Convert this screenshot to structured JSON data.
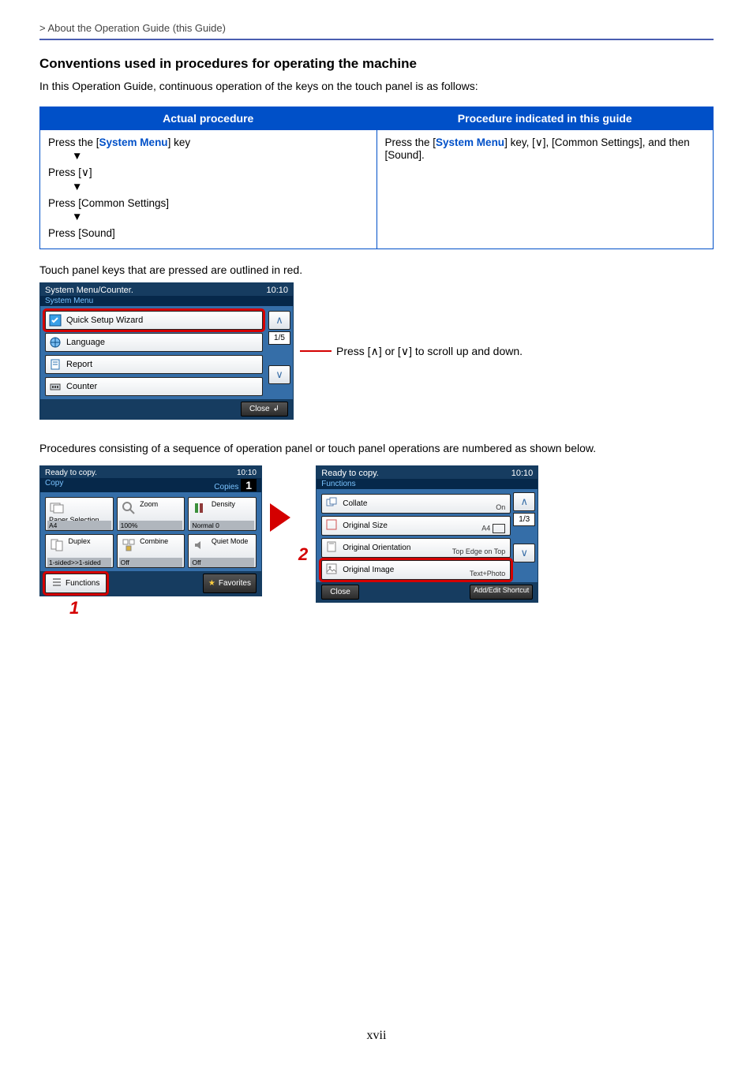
{
  "breadcrumb": " > About the Operation Guide (this Guide)",
  "heading": "Conventions used in procedures for operating the machine",
  "intro": "In this Operation Guide, continuous operation of the keys on the touch panel is as follows:",
  "table": {
    "h1": "Actual procedure",
    "h2": "Procedure indicated in this guide",
    "actual": {
      "s1a": "Press the [",
      "s1b": "System Menu",
      "s1c": "] key",
      "s2": "Press [∨]",
      "s3": "Press [Common Settings]",
      "s4": "Press [Sound]"
    },
    "right": {
      "a": "Press the [",
      "b": "System Menu",
      "c": "] key, [∨], [Common Settings], and then [Sound]."
    }
  },
  "note_outlined": "Touch panel keys that are pressed are outlined in red.",
  "sysmenu_panel": {
    "title": "System Menu/Counter.",
    "time": "10:10",
    "subbar": "System Menu",
    "items": [
      "Quick Setup Wizard",
      "Language",
      "Report",
      "Counter"
    ],
    "page": "1/5",
    "close": "Close"
  },
  "scroll_tip": "Press [∧] or [∨] to scroll up and down.",
  "seq_text": "Procedures consisting of a sequence of operation panel or touch panel operations are numbered as shown below.",
  "copy_panel": {
    "title": "Ready to copy.",
    "time": "10:10",
    "subbar_label": "Copy",
    "copies_label": "Copies",
    "copies_value": "1",
    "cells": [
      {
        "label": "Paper Selection",
        "val": "A4"
      },
      {
        "label": "Zoom",
        "val": "100%"
      },
      {
        "label": "Density",
        "val": "Normal 0"
      },
      {
        "label": "Duplex",
        "val": "1-sided>>1-sided"
      },
      {
        "label": "Combine",
        "val": "Off"
      },
      {
        "label": "Quiet Mode",
        "val": "Off"
      }
    ],
    "functions": "Functions",
    "favorites": "Favorites"
  },
  "func_panel": {
    "title": "Ready to copy.",
    "time": "10:10",
    "subbar": "Functions",
    "items": [
      {
        "label": "Collate",
        "val": "On"
      },
      {
        "label": "Original Size",
        "val": "A4"
      },
      {
        "label": "Original Orientation",
        "val": "Top Edge on Top"
      },
      {
        "label": "Original Image",
        "val": "Text+Photo"
      }
    ],
    "page": "1/3",
    "close": "Close",
    "shortcut": "Add/Edit Shortcut"
  },
  "nums": {
    "one": "1",
    "two": "2"
  },
  "page_number": "xvii",
  "chart_data": null
}
